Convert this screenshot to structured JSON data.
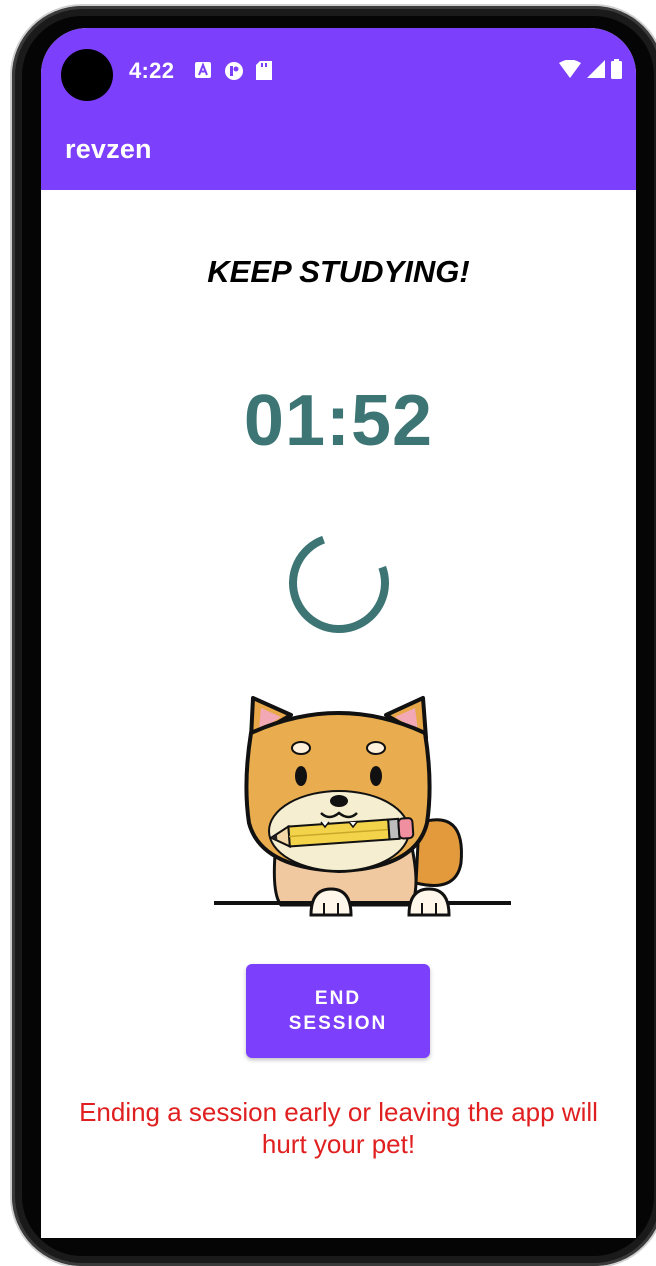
{
  "status_bar": {
    "time": "4:22",
    "icons": [
      "notification-a-icon",
      "notification-p-icon",
      "sd-card-icon",
      "wifi-icon",
      "signal-icon",
      "battery-icon"
    ]
  },
  "app_bar": {
    "title": "revzen"
  },
  "main": {
    "heading": "KEEP STUDYING!",
    "timer": "01:52",
    "progress": 0.75,
    "pet_icon": "shiba-pet-with-pencil",
    "end_button_label": "END SESSION",
    "warning": "Ending a session early or leaving the app will hurt your pet!"
  },
  "colors": {
    "accent": "#7c3ffc",
    "timer": "#3d7575",
    "warning": "#e02020"
  }
}
